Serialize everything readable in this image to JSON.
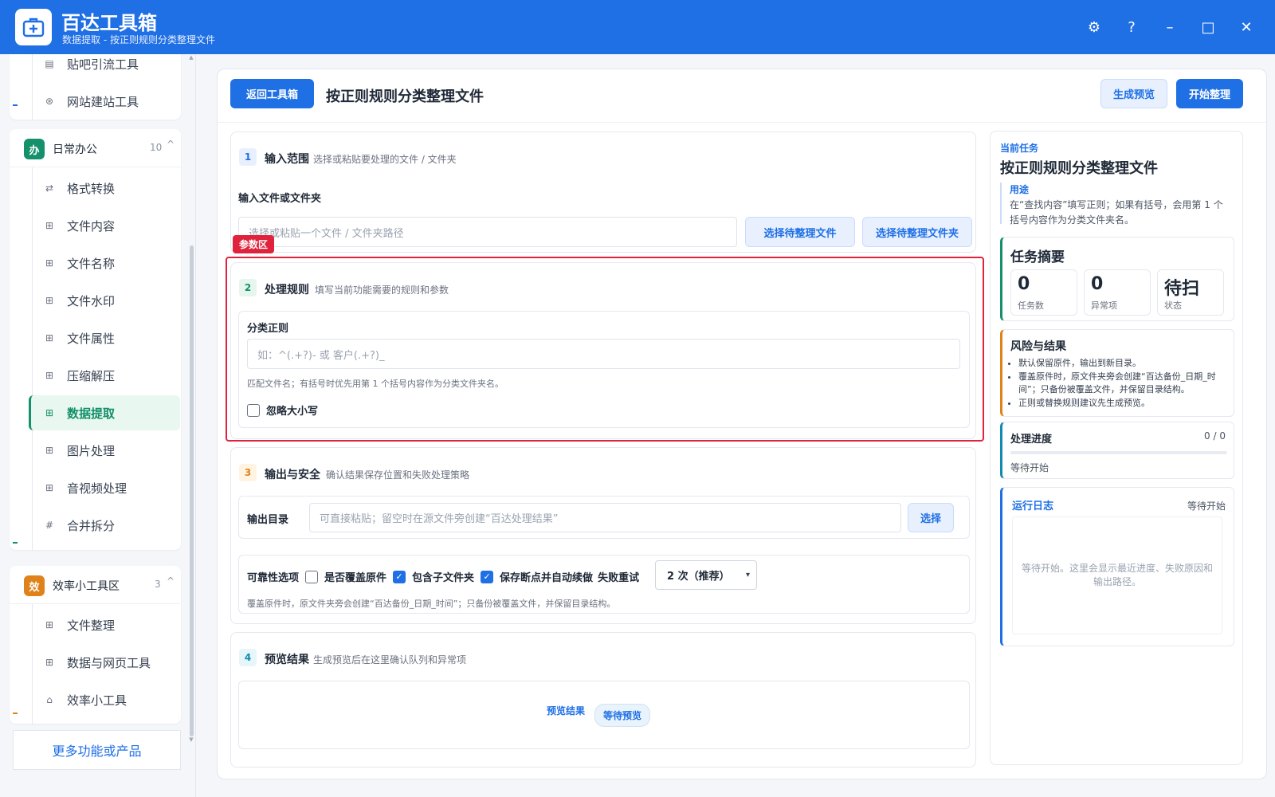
{
  "app": {
    "title": "百达工具箱",
    "subtitle": "数据提取 - 按正则规则分类整理文件",
    "controls": {
      "settings": "⚙",
      "help": "?",
      "minimize": "–",
      "maximize": "□",
      "close": "✕"
    }
  },
  "sidebar": {
    "top_items": [
      {
        "label": "贴吧引流工具",
        "icon": "doc-icon"
      },
      {
        "label": "网站建站工具",
        "icon": "globe-icon"
      }
    ],
    "group_office": {
      "icon_char": "办",
      "name": "日常办公",
      "count": "10",
      "caret": "^",
      "color": "#14906a",
      "items": [
        {
          "label": "格式转换",
          "glyph": "⇄"
        },
        {
          "label": "文件内容",
          "glyph": "⊞"
        },
        {
          "label": "文件名称",
          "glyph": "⊞"
        },
        {
          "label": "文件水印",
          "glyph": "⊞"
        },
        {
          "label": "文件属性",
          "glyph": "⊞"
        },
        {
          "label": "压缩解压",
          "glyph": "⊞"
        },
        {
          "label": "数据提取",
          "glyph": "⊞",
          "active": true
        },
        {
          "label": "图片处理",
          "glyph": "⊞"
        },
        {
          "label": "音视频处理",
          "glyph": "⊞"
        },
        {
          "label": "合并拆分",
          "glyph": "#"
        }
      ]
    },
    "group_efficiency": {
      "icon_char": "效",
      "name": "效率小工具区",
      "count": "3",
      "caret": "^",
      "color": "#e0821a",
      "items": [
        {
          "label": "文件整理",
          "glyph": "⊞"
        },
        {
          "label": "数据与网页工具",
          "glyph": "⊞"
        },
        {
          "label": "效率小工具",
          "glyph": "⌂"
        }
      ]
    },
    "more_label": "更多功能或产品"
  },
  "main": {
    "back_label": "返回工具箱",
    "page_title": "按正则规则分类整理文件",
    "preview_label": "生成预览",
    "start_label": "开始整理",
    "section1": {
      "num": "1",
      "title": "输入范围",
      "desc": "选择或粘贴要处理的文件 / 文件夹",
      "field_label": "输入文件或文件夹",
      "input_placeholder": "选择或粘贴一个文件 / 文件夹路径",
      "pick_file_label": "选择待整理文件",
      "pick_folder_label": "选择待整理文件夹"
    },
    "highlight_tag": "参数区",
    "section2": {
      "num": "2",
      "title": "处理规则",
      "desc": "填写当前功能需要的规则和参数",
      "regex_label": "分类正则",
      "regex_placeholder": "如：^(.+?)- 或 客户(.+?)_",
      "regex_hint": "匹配文件名；有括号时优先用第 1 个括号内容作为分类文件夹名。",
      "ignore_case_label": "忽略大小写",
      "ignore_case_checked": false
    },
    "section3": {
      "num": "3",
      "title": "输出与安全",
      "desc": "确认结果保存位置和失败处理策略",
      "output_label": "输出目录",
      "output_placeholder": "可直接粘贴；留空时在源文件旁创建“百达处理结果”",
      "choose_label": "选择",
      "reliability_label": "可靠性选项",
      "opt_overwrite": "是否覆盖原件",
      "opt_overwrite_checked": false,
      "opt_subfolders": "包含子文件夹",
      "opt_subfolders_checked": true,
      "opt_resume": "保存断点并自动续做",
      "opt_resume_checked": true,
      "retry_label": "失败重试",
      "retry_value": "2 次（推荐）",
      "reliability_hint": "覆盖原件时，原文件夹旁会创建“百达备份_日期_时间”；只备份被覆盖文件，并保留目录结构。"
    },
    "section4": {
      "num": "4",
      "title": "预览结果",
      "desc": "生成预览后在这里确认队列和异常项",
      "result_label": "预览结果",
      "result_badge": "等待预览"
    }
  },
  "right_panel": {
    "current_task_label": "当前任务",
    "task_title": "按正则规则分类整理文件",
    "usage_label": "用途",
    "usage_text": "在“查找内容”填写正则；如果有括号，会用第 1 个括号内容作为分类文件夹名。",
    "summary": {
      "title": "任务摘要",
      "stats": [
        {
          "value": "0",
          "label": "任务数"
        },
        {
          "value": "0",
          "label": "异常项"
        },
        {
          "value": "待扫",
          "label": "状态"
        }
      ]
    },
    "risk": {
      "title": "风险与结果",
      "items": [
        "默认保留原件，输出到新目录。",
        "覆盖原件时，原文件夹旁会创建“百达备份_日期_时间”；只备份被覆盖文件，并保留目录结构。",
        "正则或替换规则建议先生成预览。"
      ]
    },
    "progress": {
      "title": "处理进度",
      "count": "0 / 0",
      "progress": 0,
      "status": "等待开始"
    },
    "log": {
      "title": "运行日志",
      "status": "等待开始",
      "placeholder": "等待开始。这里会显示最近进度、失败原因和输出路径。"
    }
  },
  "colors": {
    "primary": "#1f6fe5",
    "green": "#14906a",
    "orange": "#e0821a",
    "red": "#e0233d"
  }
}
